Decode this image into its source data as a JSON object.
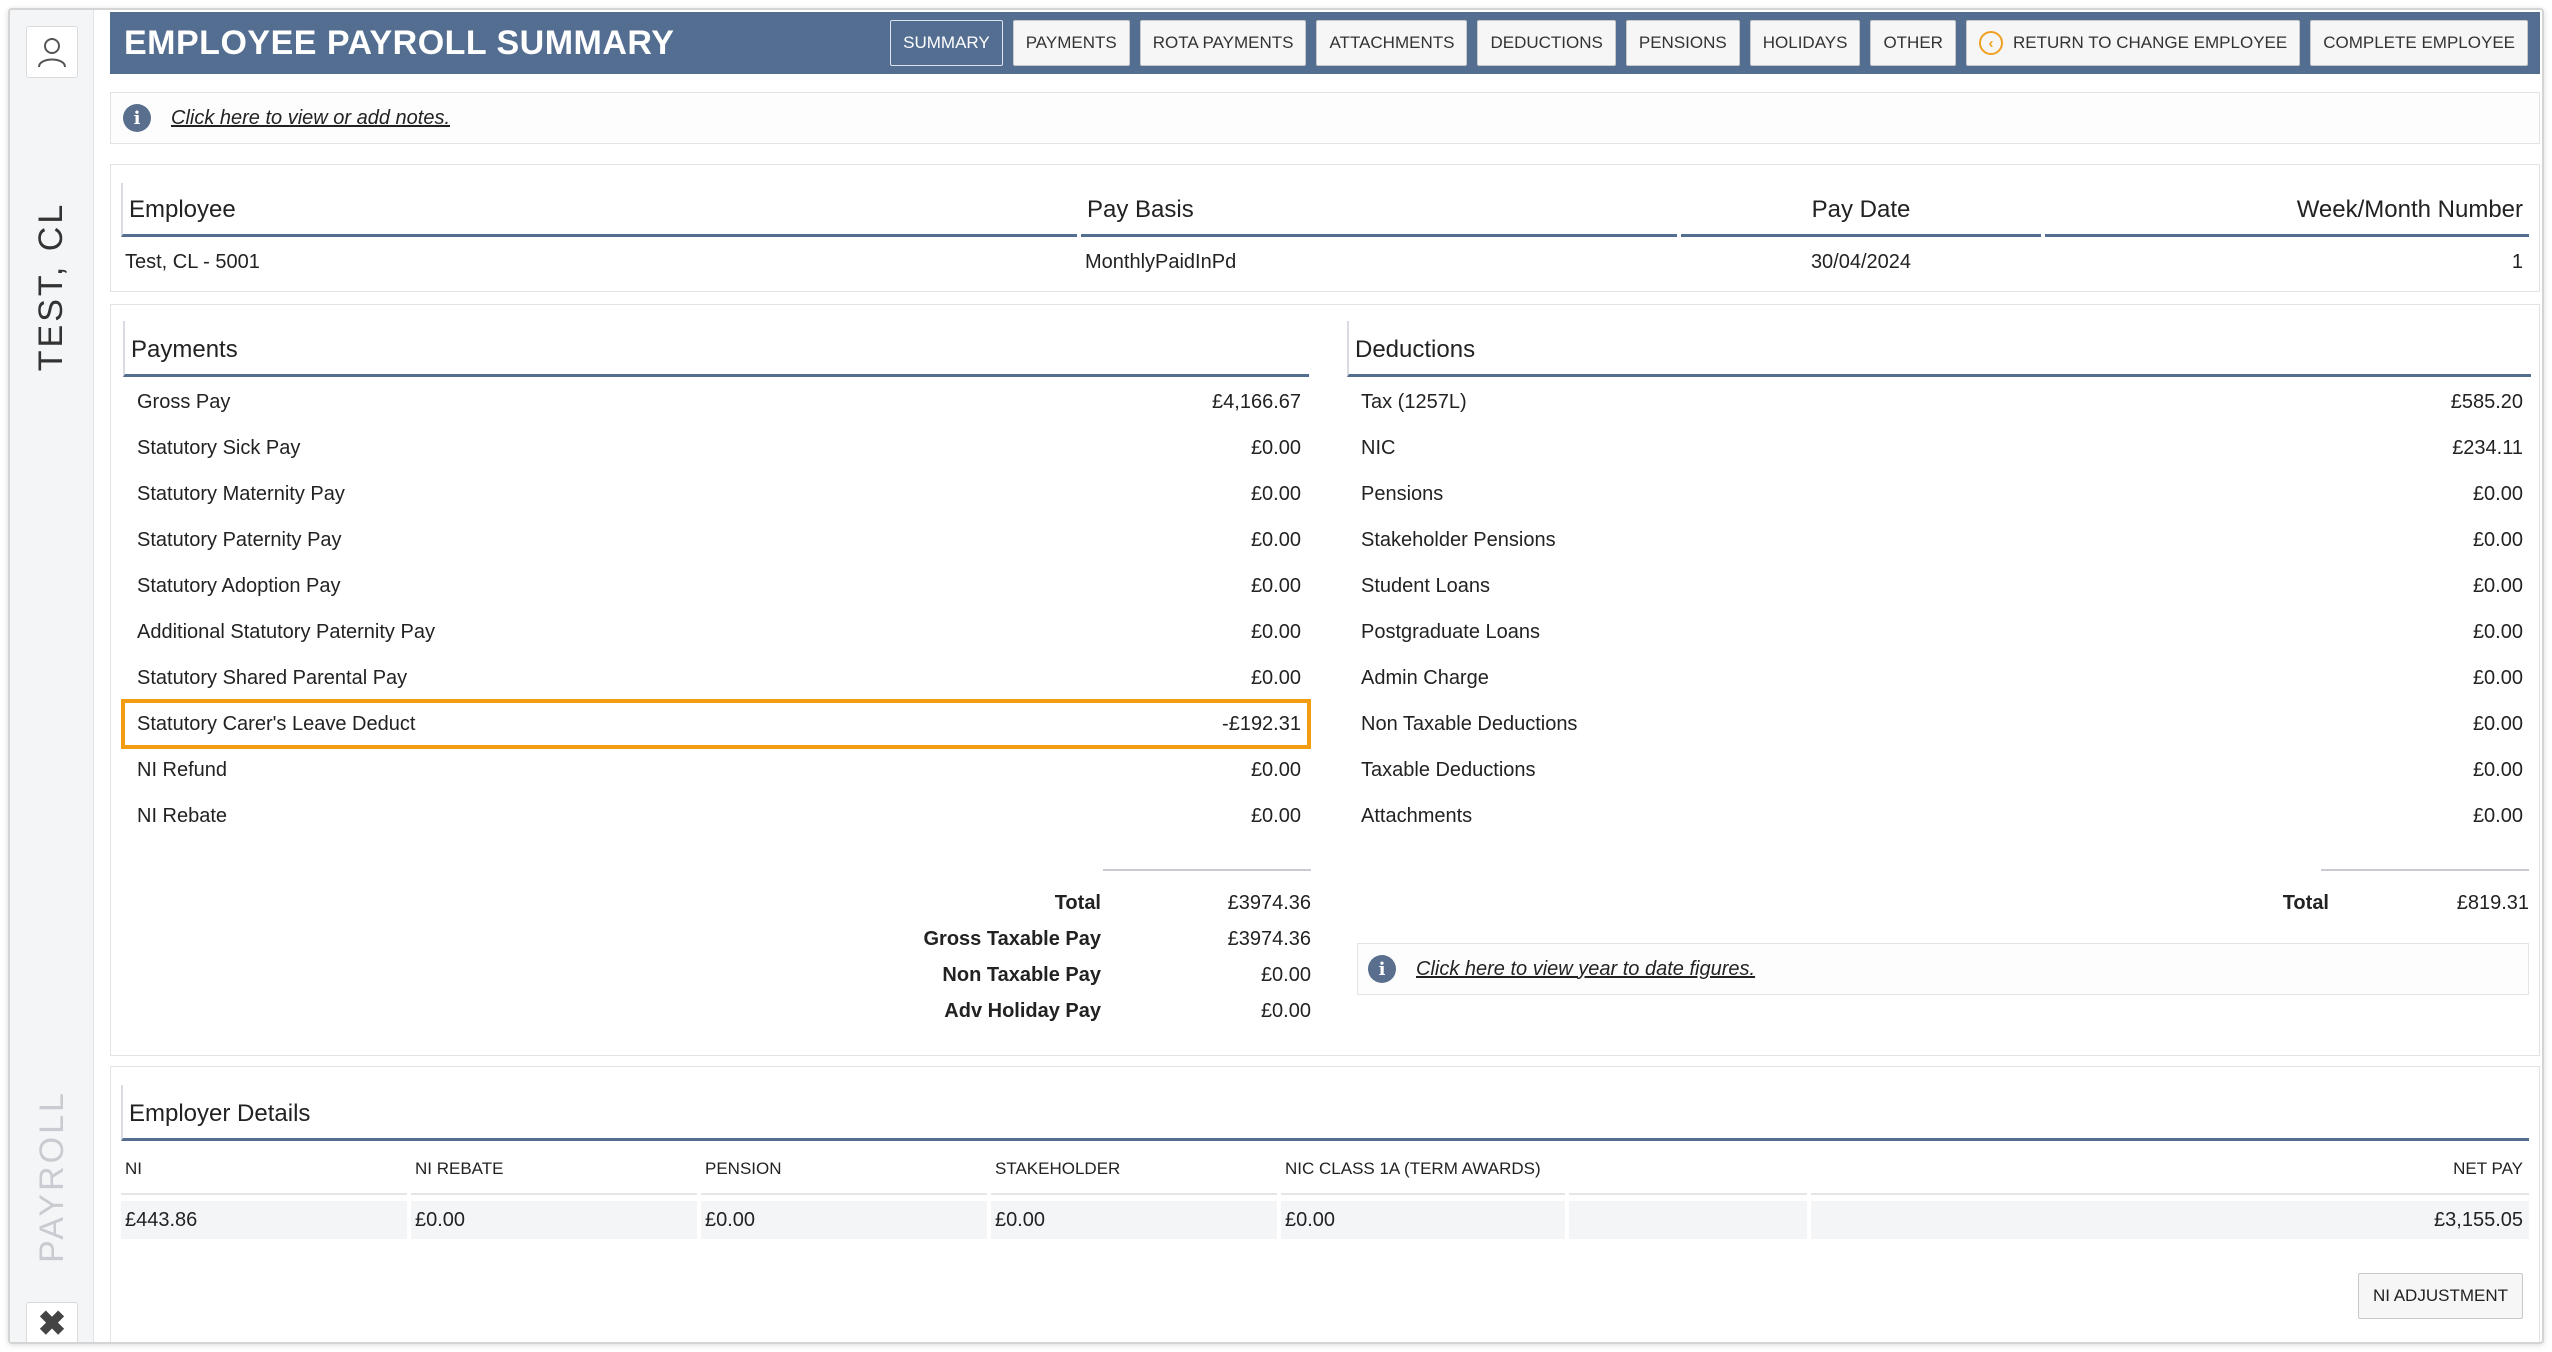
{
  "header": {
    "title": "EMPLOYEE PAYROLL SUMMARY",
    "tabs": [
      "SUMMARY",
      "PAYMENTS",
      "ROTA PAYMENTS",
      "ATTACHMENTS",
      "DEDUCTIONS",
      "PENSIONS",
      "HOLIDAYS",
      "OTHER"
    ],
    "return_label": "RETURN TO CHANGE EMPLOYEE",
    "complete_label": "COMPLETE EMPLOYEE"
  },
  "sidebar": {
    "employee_name": "TEST, CL",
    "module": "PAYROLL"
  },
  "notes": {
    "link": "Click here to view or add notes."
  },
  "employee_table": {
    "headers": [
      "Employee",
      "Pay Basis",
      "Pay Date",
      "Week/Month Number"
    ],
    "values": [
      "Test, CL - 5001",
      "MonthlyPaidInPd",
      "30/04/2024",
      "1"
    ]
  },
  "payments": {
    "title": "Payments",
    "items": [
      {
        "label": "Gross Pay",
        "value": "£4,166.67"
      },
      {
        "label": "Statutory Sick Pay",
        "value": "£0.00"
      },
      {
        "label": "Statutory Maternity Pay",
        "value": "£0.00"
      },
      {
        "label": "Statutory Paternity Pay",
        "value": "£0.00"
      },
      {
        "label": "Statutory Adoption Pay",
        "value": "£0.00"
      },
      {
        "label": "Additional Statutory Paternity Pay",
        "value": "£0.00"
      },
      {
        "label": "Statutory Shared Parental Pay",
        "value": "£0.00"
      },
      {
        "label": "Statutory Carer's Leave Deduct",
        "value": "-£192.31"
      },
      {
        "label": "NI Refund",
        "value": "£0.00"
      },
      {
        "label": "NI Rebate",
        "value": "£0.00"
      }
    ],
    "totals": [
      {
        "label": "Total",
        "value": "£3974.36"
      },
      {
        "label": "Gross Taxable Pay",
        "value": "£3974.36"
      },
      {
        "label": "Non Taxable Pay",
        "value": "£0.00"
      },
      {
        "label": "Adv Holiday Pay",
        "value": "£0.00"
      }
    ]
  },
  "deductions": {
    "title": "Deductions",
    "items": [
      {
        "label": "Tax (1257L)",
        "value": "£585.20"
      },
      {
        "label": "NIC",
        "value": "£234.11"
      },
      {
        "label": "Pensions",
        "value": "£0.00"
      },
      {
        "label": "Stakeholder Pensions",
        "value": "£0.00"
      },
      {
        "label": "Student Loans",
        "value": "£0.00"
      },
      {
        "label": "Postgraduate Loans",
        "value": "£0.00"
      },
      {
        "label": "Admin Charge",
        "value": "£0.00"
      },
      {
        "label": "Non Taxable Deductions",
        "value": "£0.00"
      },
      {
        "label": "Taxable Deductions",
        "value": "£0.00"
      },
      {
        "label": "Attachments",
        "value": "£0.00"
      }
    ],
    "total_label": "Total",
    "total_value": "£819.31",
    "ytd_link": "Click here to view year to date figures."
  },
  "employer": {
    "title": "Employer Details",
    "columns": [
      "NI",
      "NI REBATE",
      "PENSION",
      "STAKEHOLDER",
      "NIC CLASS 1A (TERM AWARDS)",
      "",
      "NET PAY"
    ],
    "values": [
      "£443.86",
      "£0.00",
      "£0.00",
      "£0.00",
      "£0.00",
      "",
      "£3,155.05"
    ],
    "ni_adjustment_label": "NI ADJUSTMENT"
  },
  "colors": {
    "header_bg": "#546e92",
    "highlight": "#f39c12"
  }
}
